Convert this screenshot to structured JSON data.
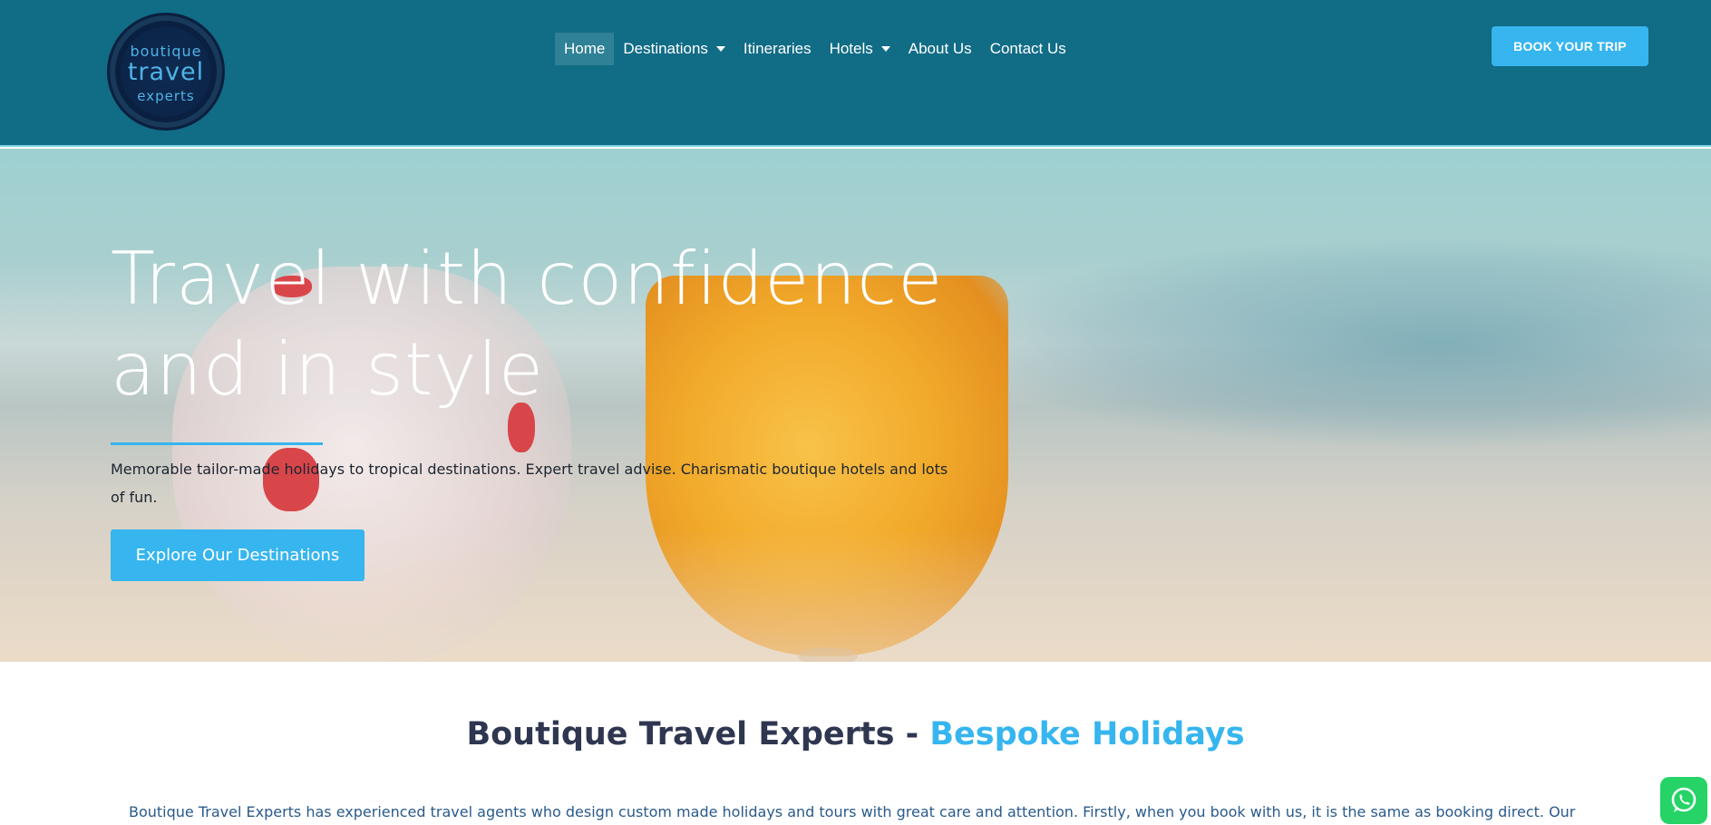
{
  "header": {
    "logo": {
      "line1": "boutique",
      "line2": "travel",
      "line3": "experts"
    },
    "nav": [
      {
        "label": "Home",
        "active": true,
        "has_dropdown": false
      },
      {
        "label": "Destinations",
        "active": false,
        "has_dropdown": true
      },
      {
        "label": "Itineraries",
        "active": false,
        "has_dropdown": false
      },
      {
        "label": "Hotels",
        "active": false,
        "has_dropdown": true
      },
      {
        "label": "About Us",
        "active": false,
        "has_dropdown": false
      },
      {
        "label": "Contact Us",
        "active": false,
        "has_dropdown": false
      }
    ],
    "cta_label": "BOOK YOUR TRIP"
  },
  "hero": {
    "title_line1": "Travel with confidence",
    "title_line2": "and in style",
    "subtitle": "Memorable tailor-made holidays to tropical destinations. Expert travel advise. Charismatic boutique hotels and lots of fun.",
    "button_label": "Explore Our Destinations"
  },
  "main": {
    "title_prefix": "Boutique Travel Experts - ",
    "title_accent": "Bespoke Holidays",
    "intro": "Boutique Travel Experts has experienced travel agents who design custom made holidays and tours with great care and attention. Firstly, when you book with us, it is the same as booking direct. Our"
  },
  "colors": {
    "header_bg": "#116c86",
    "accent": "#36b5ef",
    "heading": "#2f3650",
    "whatsapp": "#25d366"
  },
  "icons": {
    "chat": "whatsapp-icon",
    "dropdown": "chevron-down-icon"
  }
}
